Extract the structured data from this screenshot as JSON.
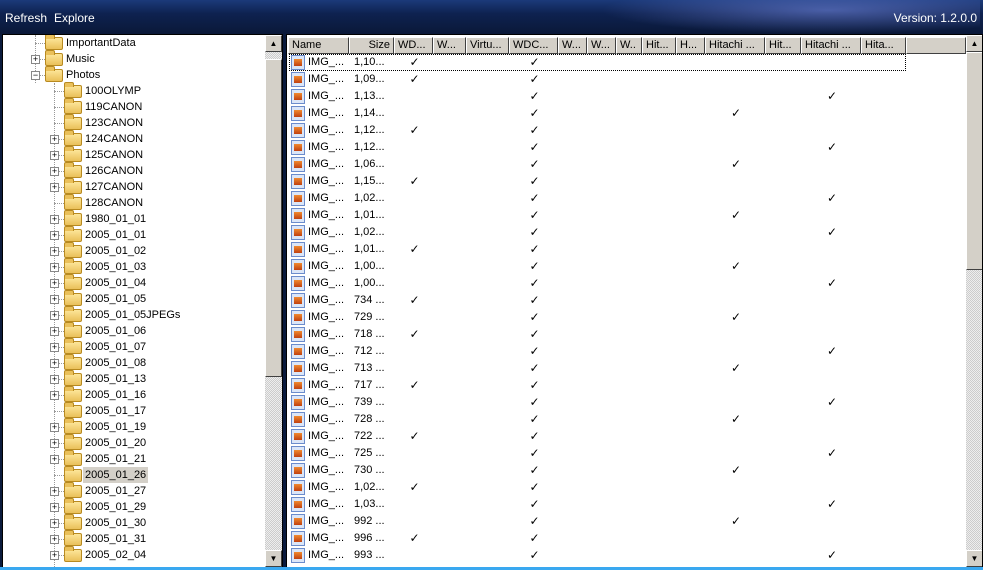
{
  "menu": {
    "refresh": "Refresh",
    "explore": "Explore"
  },
  "version": "Version: 1.2.0.0",
  "tree": [
    {
      "label": "ImportantData",
      "level": 1,
      "expander": ""
    },
    {
      "label": "Music",
      "level": 1,
      "expander": "+"
    },
    {
      "label": "Photos",
      "level": 1,
      "expander": "-"
    },
    {
      "label": "100OLYMP",
      "level": 2,
      "expander": ""
    },
    {
      "label": "119CANON",
      "level": 2,
      "expander": ""
    },
    {
      "label": "123CANON",
      "level": 2,
      "expander": ""
    },
    {
      "label": "124CANON",
      "level": 2,
      "expander": "+"
    },
    {
      "label": "125CANON",
      "level": 2,
      "expander": "+"
    },
    {
      "label": "126CANON",
      "level": 2,
      "expander": "+"
    },
    {
      "label": "127CANON",
      "level": 2,
      "expander": "+"
    },
    {
      "label": "128CANON",
      "level": 2,
      "expander": ""
    },
    {
      "label": "1980_01_01",
      "level": 2,
      "expander": "+"
    },
    {
      "label": "2005_01_01",
      "level": 2,
      "expander": "+"
    },
    {
      "label": "2005_01_02",
      "level": 2,
      "expander": "+"
    },
    {
      "label": "2005_01_03",
      "level": 2,
      "expander": "+"
    },
    {
      "label": "2005_01_04",
      "level": 2,
      "expander": "+"
    },
    {
      "label": "2005_01_05",
      "level": 2,
      "expander": "+"
    },
    {
      "label": "2005_01_05JPEGs",
      "level": 2,
      "expander": "+"
    },
    {
      "label": "2005_01_06",
      "level": 2,
      "expander": "+"
    },
    {
      "label": "2005_01_07",
      "level": 2,
      "expander": "+"
    },
    {
      "label": "2005_01_08",
      "level": 2,
      "expander": "+"
    },
    {
      "label": "2005_01_13",
      "level": 2,
      "expander": "+"
    },
    {
      "label": "2005_01_16",
      "level": 2,
      "expander": "+"
    },
    {
      "label": "2005_01_17",
      "level": 2,
      "expander": ""
    },
    {
      "label": "2005_01_19",
      "level": 2,
      "expander": "+"
    },
    {
      "label": "2005_01_20",
      "level": 2,
      "expander": "+"
    },
    {
      "label": "2005_01_21",
      "level": 2,
      "expander": "+"
    },
    {
      "label": "2005_01_26",
      "level": 2,
      "expander": "",
      "selected": true
    },
    {
      "label": "2005_01_27",
      "level": 2,
      "expander": "+"
    },
    {
      "label": "2005_01_29",
      "level": 2,
      "expander": "+"
    },
    {
      "label": "2005_01_30",
      "level": 2,
      "expander": "+"
    },
    {
      "label": "2005_01_31",
      "level": 2,
      "expander": "+"
    },
    {
      "label": "2005_02_04",
      "level": 2,
      "expander": "+"
    }
  ],
  "columns": [
    "Name",
    "Size",
    "WD...",
    "W...",
    "Virtu...",
    "WDC...",
    "W...",
    "W...",
    "W..",
    "Hit...",
    "H...",
    "Hitachi ...",
    "Hit...",
    "Hitachi ...",
    "Hita..."
  ],
  "check_glyph": "✓",
  "rows": [
    {
      "name": "IMG_...",
      "size": "1,10...",
      "checks": [
        2,
        5
      ]
    },
    {
      "name": "IMG_...",
      "size": "1,09...",
      "checks": [
        2,
        5
      ]
    },
    {
      "name": "IMG_...",
      "size": "1,13...",
      "checks": [
        5,
        13
      ]
    },
    {
      "name": "IMG_...",
      "size": "1,14...",
      "checks": [
        5,
        11
      ]
    },
    {
      "name": "IMG_...",
      "size": "1,12...",
      "checks": [
        2,
        5
      ]
    },
    {
      "name": "IMG_...",
      "size": "1,12...",
      "checks": [
        5,
        13
      ]
    },
    {
      "name": "IMG_...",
      "size": "1,06...",
      "checks": [
        5,
        11
      ]
    },
    {
      "name": "IMG_...",
      "size": "1,15...",
      "checks": [
        2,
        5
      ]
    },
    {
      "name": "IMG_...",
      "size": "1,02...",
      "checks": [
        5,
        13
      ]
    },
    {
      "name": "IMG_...",
      "size": "1,01...",
      "checks": [
        5,
        11
      ]
    },
    {
      "name": "IMG_...",
      "size": "1,02...",
      "checks": [
        5,
        13
      ]
    },
    {
      "name": "IMG_...",
      "size": "1,01...",
      "checks": [
        2,
        5
      ]
    },
    {
      "name": "IMG_...",
      "size": "1,00...",
      "checks": [
        5,
        11
      ]
    },
    {
      "name": "IMG_...",
      "size": "1,00...",
      "checks": [
        5,
        13
      ]
    },
    {
      "name": "IMG_...",
      "size": "734 ...",
      "checks": [
        2,
        5
      ]
    },
    {
      "name": "IMG_...",
      "size": "729 ...",
      "checks": [
        5,
        11
      ]
    },
    {
      "name": "IMG_...",
      "size": "718 ...",
      "checks": [
        2,
        5
      ]
    },
    {
      "name": "IMG_...",
      "size": "712 ...",
      "checks": [
        5,
        13
      ]
    },
    {
      "name": "IMG_...",
      "size": "713 ...",
      "checks": [
        5,
        11
      ]
    },
    {
      "name": "IMG_...",
      "size": "717 ...",
      "checks": [
        2,
        5
      ]
    },
    {
      "name": "IMG_...",
      "size": "739 ...",
      "checks": [
        5,
        13
      ]
    },
    {
      "name": "IMG_...",
      "size": "728 ...",
      "checks": [
        5,
        11
      ]
    },
    {
      "name": "IMG_...",
      "size": "722 ...",
      "checks": [
        2,
        5
      ]
    },
    {
      "name": "IMG_...",
      "size": "725 ...",
      "checks": [
        5,
        13
      ]
    },
    {
      "name": "IMG_...",
      "size": "730 ...",
      "checks": [
        5,
        11
      ]
    },
    {
      "name": "IMG_...",
      "size": "1,02...",
      "checks": [
        2,
        5
      ]
    },
    {
      "name": "IMG_...",
      "size": "1,03...",
      "checks": [
        5,
        13
      ]
    },
    {
      "name": "IMG_...",
      "size": "992 ...",
      "checks": [
        5,
        11
      ]
    },
    {
      "name": "IMG_...",
      "size": "996 ...",
      "checks": [
        2,
        5
      ]
    },
    {
      "name": "IMG_...",
      "size": "993 ...",
      "checks": [
        5,
        13
      ]
    }
  ]
}
